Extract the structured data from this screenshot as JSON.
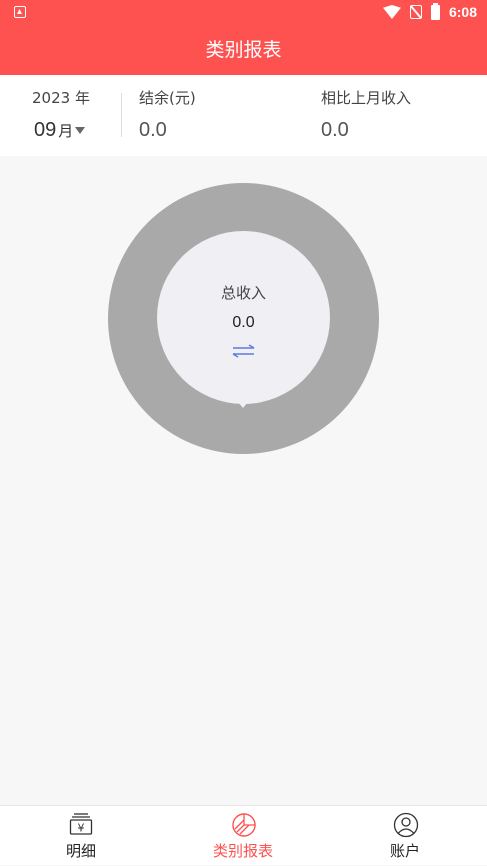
{
  "status": {
    "time": "6:08"
  },
  "header": {
    "title": "类别报表"
  },
  "summary": {
    "year": "2023 年",
    "month": "09",
    "month_unit": "月",
    "balance_label": "结余(元)",
    "balance_value": "0.0",
    "compare_label": "相比上月收入",
    "compare_value": "0.0"
  },
  "chart": {
    "center_label": "总收入",
    "center_value": "0.0",
    "ring_color": "#a9a9a9"
  },
  "tabs": [
    {
      "label": "明细",
      "icon": "ledger-yuan-icon",
      "active": false
    },
    {
      "label": "类别报表",
      "icon": "pie-chart-icon",
      "active": true
    },
    {
      "label": "账户",
      "icon": "user-icon",
      "active": false
    }
  ],
  "colors": {
    "accent": "#fe5250",
    "swap": "#5b7be0"
  }
}
